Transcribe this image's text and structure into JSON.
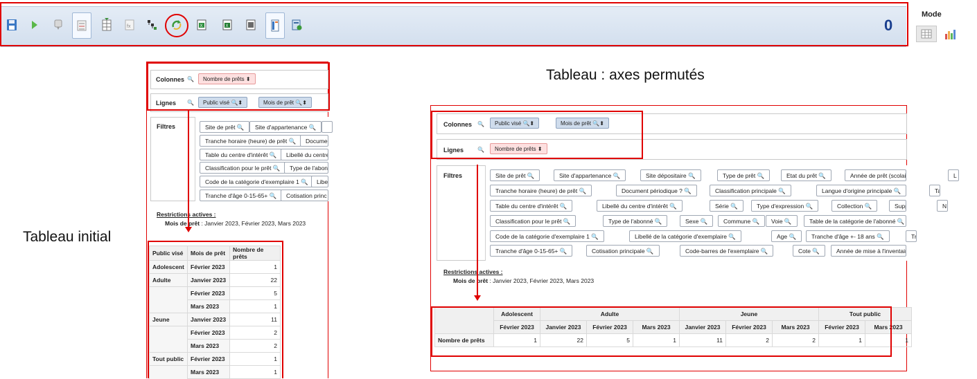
{
  "toolbar": {
    "icons": [
      "save-icon",
      "run-icon",
      "comment-icon",
      "layout-icon",
      "totals-icon",
      "formula-icon",
      "hierarchy-icon",
      "swap-axes-icon",
      "export-excel-icon",
      "export-excel-alt-icon",
      "export-sheet-icon",
      "export-pdf-icon",
      "page-layout-icon",
      "add-sheet-icon"
    ],
    "counter": "0"
  },
  "mode": {
    "title": "Mode",
    "options": [
      "table-mode-icon",
      "chart-mode-icon"
    ]
  },
  "headings": {
    "swapped": "Tableau : axes permutés",
    "initial": "Tableau initial"
  },
  "left": {
    "columns_label": "Colonnes",
    "columns_pills": [
      "Nombre de prêts"
    ],
    "rows_label": "Lignes",
    "rows_pills": [
      "Public visé",
      "Mois de prêt"
    ],
    "filters_label": "Filtres",
    "filters": [
      [
        "Site de prêt",
        "Site d'appartenance",
        ""
      ],
      [
        "Tranche horaire (heure) de prêt",
        "Docume"
      ],
      [
        "Table du centre d'intérêt",
        "Libellé du centre"
      ],
      [
        "Classification pour le prêt",
        "Type de l'abonn"
      ],
      [
        "Code de la catégorie d'exemplaire 1",
        "Libe"
      ],
      [
        "Tranche d'âge 0-15-65+",
        "Cotisation princ"
      ]
    ],
    "restrictions_title": "Restrictions actives :",
    "restrictions_key": "Mois de prêt",
    "restrictions_value": ": Janvier 2023, Février 2023, Mars 2023",
    "table": {
      "headers": [
        "Public visé",
        "Mois de prêt",
        "Nombre de prêts"
      ],
      "rows": [
        [
          "Adolescent",
          "Février 2023",
          "1"
        ],
        [
          "Adulte",
          "Janvier 2023",
          "22"
        ],
        [
          "",
          "Février 2023",
          "5"
        ],
        [
          "",
          "Mars 2023",
          "1"
        ],
        [
          "Jeune",
          "Janvier 2023",
          "11"
        ],
        [
          "",
          "Février 2023",
          "2"
        ],
        [
          "",
          "Mars 2023",
          "2"
        ],
        [
          "Tout public",
          "Février 2023",
          "1"
        ],
        [
          "",
          "Mars 2023",
          "1"
        ]
      ]
    }
  },
  "right": {
    "columns_label": "Colonnes",
    "columns_pills": [
      "Public visé",
      "Mois de prêt"
    ],
    "rows_label": "Lignes",
    "rows_pills": [
      "Nombre de prêts"
    ],
    "filters_label": "Filtres",
    "filters": [
      [
        "Site de prêt",
        "Site d'appartenance",
        "Site dépositaire",
        "Type de prêt",
        "Etat du prêt",
        "Année de prêt (scolaire)",
        "L"
      ],
      [
        "Tranche horaire (heure) de prêt",
        "Document périodique ?",
        "Classification principale",
        "Langue d'origine principale",
        "Table de"
      ],
      [
        "Table du centre d'intérêt",
        "Libellé du centre d'intérêt",
        "Série",
        "Type d'expression",
        "Collection",
        "Support",
        "N"
      ],
      [
        "Classification pour le prêt",
        "Type de l'abonné",
        "Sexe",
        "Commune",
        "Voie",
        "Table de la catégorie de l'abonné"
      ],
      [
        "Code de la catégorie d'exemplaire 1",
        "Libellé de la catégorie d'exemplaire",
        "Age",
        "Tranche d'âge +- 18 ans",
        "Tranche"
      ],
      [
        "Tranche d'âge 0-15-65+",
        "Cotisation principale",
        "Code-barres de l'exemplaire",
        "Cote",
        "Année de mise à l'inventaire"
      ]
    ],
    "restrictions_title": "Restrictions actives :",
    "restrictions_key": "Mois de prêt",
    "restrictions_value": ": Janvier 2023, Février 2023, Mars 2023",
    "table": {
      "groups": [
        {
          "name": "Adolescent",
          "months": [
            "Février 2023"
          ]
        },
        {
          "name": "Adulte",
          "months": [
            "Janvier 2023",
            "Février 2023",
            "Mars 2023"
          ]
        },
        {
          "name": "Jeune",
          "months": [
            "Janvier 2023",
            "Février 2023",
            "Mars 2023"
          ]
        },
        {
          "name": "Tout public",
          "months": [
            "Février 2023",
            "Mars 2023"
          ]
        }
      ],
      "row_label": "Nombre de prêts",
      "values": [
        "1",
        "22",
        "5",
        "1",
        "11",
        "2",
        "2",
        "1",
        "1"
      ]
    }
  }
}
